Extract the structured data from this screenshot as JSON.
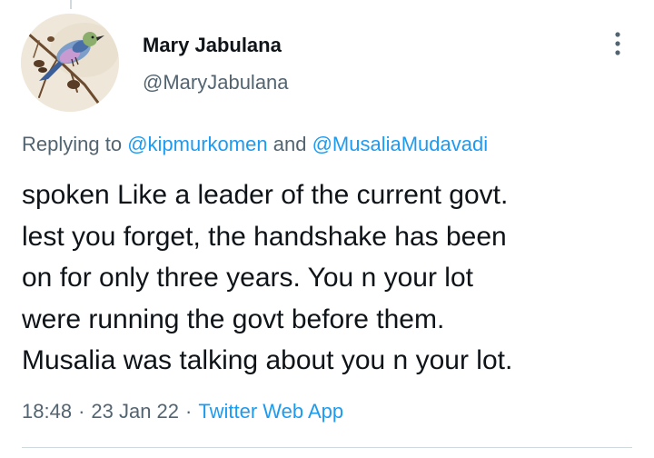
{
  "tweet": {
    "author": {
      "name": "Mary Jabulana",
      "handle": "@MaryJabulana",
      "avatar_icon": "bird-on-branch-avatar"
    },
    "more_icon": "more-vertical-icon",
    "replying": {
      "prefix": "Replying to",
      "mention_1": "@kipmurkomen",
      "conjunction": "and",
      "mention_2": "@MusaliaMudavadi"
    },
    "text_lines": [
      "spoken Like a leader of the current govt.",
      "lest you forget, the handshake has been",
      "on for only three years. You n your lot",
      "were running the govt before them.",
      "Musalia was talking about you n your lot."
    ],
    "meta": {
      "time": "18:48",
      "separator": "·",
      "date": "23 Jan 22",
      "source": "Twitter Web App"
    }
  },
  "colors": {
    "primary_text": "#0f1419",
    "secondary_text": "#536471",
    "link": "#1d9bf0",
    "divider": "#cfd9de"
  }
}
